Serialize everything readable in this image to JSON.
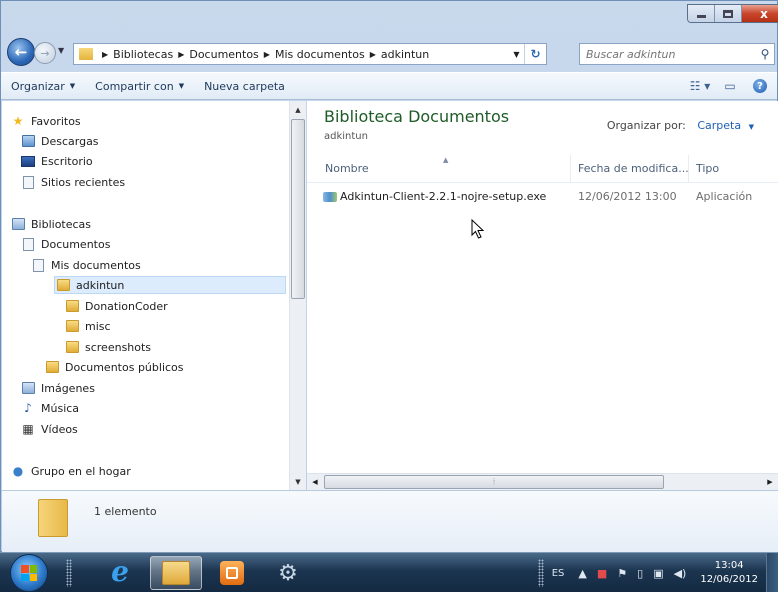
{
  "window": {
    "close_glyph": "x"
  },
  "address": {
    "crumbs": [
      "Bibliotecas",
      "Documentos",
      "Mis documentos",
      "adkintun"
    ],
    "search_placeholder": "Buscar adkintun"
  },
  "toolbar": {
    "organize": "Organizar",
    "share": "Compartir con",
    "new_folder": "Nueva carpeta"
  },
  "nav": {
    "favorites": "Favoritos",
    "downloads": "Descargas",
    "desktop": "Escritorio",
    "recent": "Sitios recientes",
    "libraries": "Bibliotecas",
    "documents": "Documentos",
    "my_documents": "Mis documentos",
    "adkintun": "adkintun",
    "donationcoder": "DonationCoder",
    "misc": "misc",
    "screenshots": "screenshots",
    "public_documents": "Documentos públicos",
    "images": "Imágenes",
    "music": "Música",
    "videos": "Vídeos",
    "homegroup": "Grupo en el hogar"
  },
  "content": {
    "title": "Biblioteca Documentos",
    "subtitle": "adkintun",
    "arrange_label": "Organizar por:",
    "arrange_value": "Carpeta",
    "columns": {
      "name": "Nombre",
      "date": "Fecha de modifica...",
      "type": "Tipo"
    },
    "files": [
      {
        "name": "Adkintun-Client-2.2.1-nojre-setup.exe",
        "date": "12/06/2012 13:00",
        "type": "Aplicación"
      }
    ]
  },
  "details": {
    "count": "1 elemento"
  },
  "taskbar": {
    "lang": "ES",
    "time": "13:04",
    "date": "12/06/2012"
  },
  "colors": {
    "library_title": "#1e5b27",
    "link_blue": "#1e5fb4",
    "selection": "#dcecfc"
  }
}
